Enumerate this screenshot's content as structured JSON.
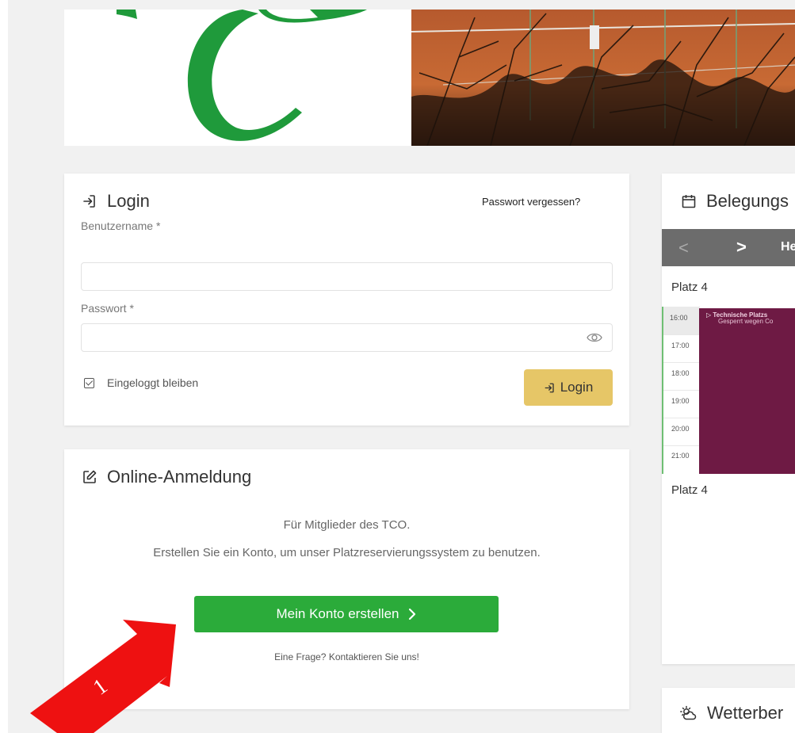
{
  "login": {
    "title": "Login",
    "forgot_password": "Passwort vergessen?",
    "username_label": "Benutzername *",
    "username_value": "",
    "password_label": "Passwort *",
    "password_value": "",
    "remember_me": "Eingeloggt bleiben",
    "submit": "Login"
  },
  "signup": {
    "title": "Online-Anmeldung",
    "line1": "Für Mitglieder des TCO.",
    "line2": "Erstellen Sie ein Konto, um unser Platzreservierungssystem zu benutzen.",
    "create_button": "Mein Konto erstellen",
    "contact": "Eine Frage? Kontaktieren Sie uns!"
  },
  "booking": {
    "title": "Belegungs",
    "nav_prev": "<",
    "nav_next": ">",
    "today": "He",
    "court_top": "Platz 4",
    "court_bottom": "Platz 4",
    "times": [
      "16:00",
      "17:00",
      "18:00",
      "19:00",
      "20:00",
      "21:00"
    ],
    "event_title": "Technische Platzs",
    "event_sub": "Gesperrt wegen Co"
  },
  "weather": {
    "title": "Wetterber"
  },
  "annotation": {
    "label": "1"
  },
  "colors": {
    "accent_green": "#2bab3a",
    "login_button": "#e6c667",
    "event": "#6e1a44",
    "annotation_red": "#ee1111"
  }
}
